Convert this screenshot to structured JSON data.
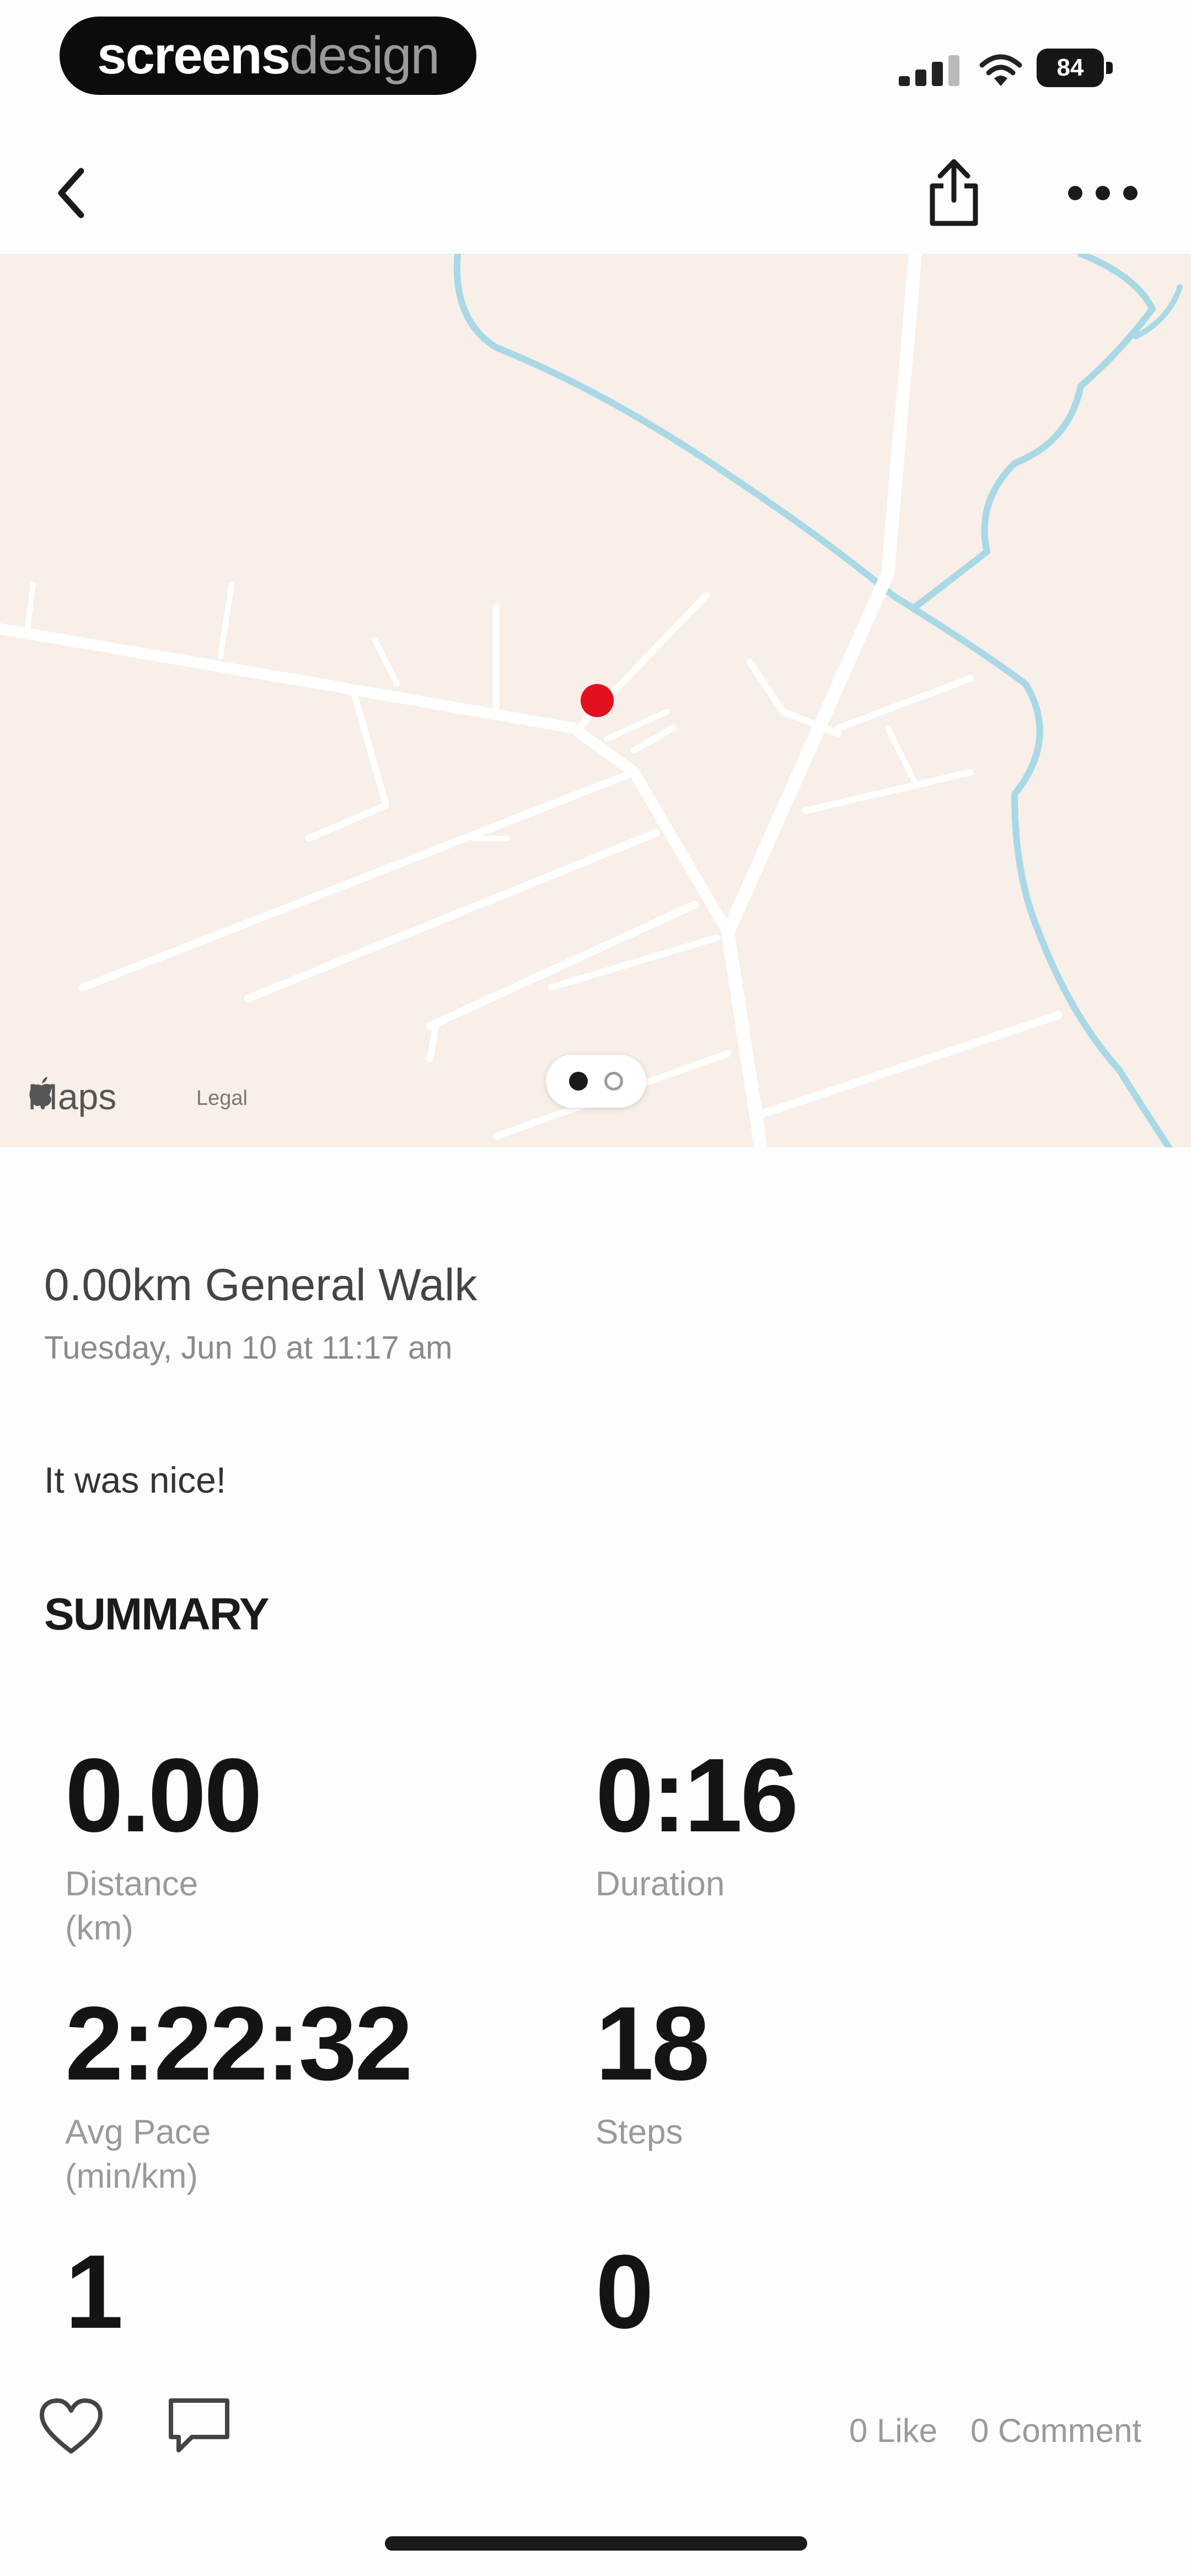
{
  "status_bar": {
    "brand_part1": "screens",
    "brand_part2": "design",
    "battery_level": "84"
  },
  "nav": {
    "back": "back",
    "share": "share",
    "more": "more"
  },
  "map": {
    "logo_text": "Maps",
    "legal_text": "Legal",
    "pager": {
      "pages": 2,
      "active_index": 0
    }
  },
  "activity": {
    "title": "0.00km General Walk",
    "date": "Tuesday, Jun 10 at 11:17 am",
    "note": "It was nice!"
  },
  "summary": {
    "title": "SUMMARY",
    "stats": [
      {
        "value": "0.00",
        "label_line1": "Distance",
        "label_line2": "(km)"
      },
      {
        "value": "0:16",
        "label_line1": "Duration",
        "label_line2": ""
      },
      {
        "value": "2:22:32",
        "label_line1": "Avg Pace",
        "label_line2": "(min/km)"
      },
      {
        "value": "18",
        "label_line1": "Steps",
        "label_line2": ""
      },
      {
        "value": "1",
        "label_line1": "",
        "label_line2": ""
      },
      {
        "value": "0",
        "label_line1": "",
        "label_line2": ""
      }
    ]
  },
  "social": {
    "likes_label": "0 Like",
    "comments_label": "0 Comment"
  },
  "colors": {
    "map_bg": "#f7efe8",
    "road": "#ffffff",
    "water": "#a9d8e6",
    "location_pin": "#e3101f"
  },
  "icons": {
    "back": "chevron-left-icon",
    "share": "share-icon",
    "more": "more-dots-icon",
    "like": "heart-icon",
    "comment": "comment-icon"
  }
}
